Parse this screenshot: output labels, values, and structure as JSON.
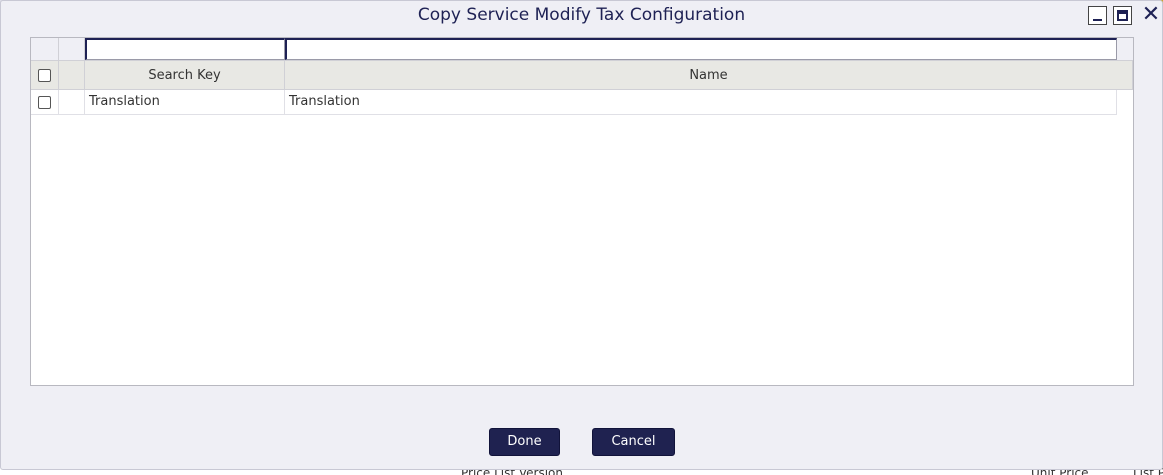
{
  "dialog": {
    "title": "Copy Service Modify Tax Configuration",
    "minimize_icon": "minimize-icon",
    "maximize_icon": "maximize-icon",
    "close_icon": "close-icon",
    "close_glyph": "✕"
  },
  "grid": {
    "filters": {
      "search_key": "",
      "name": ""
    },
    "columns": [
      "Search Key",
      "Name"
    ],
    "rows": [
      {
        "search_key": "Translation",
        "name": "Translation",
        "selected": false
      }
    ],
    "select_all": false
  },
  "buttons": {
    "done": "Done",
    "cancel": "Cancel"
  },
  "background": {
    "footer_label_1": "Price List Version",
    "footer_label_2": "Unit Price",
    "footer_label_3": "List P"
  },
  "colors": {
    "accent": "#1f2250",
    "title": "#1e2154",
    "dialog_bg": "#efeff5",
    "header_bg": "#e8e8e4"
  }
}
